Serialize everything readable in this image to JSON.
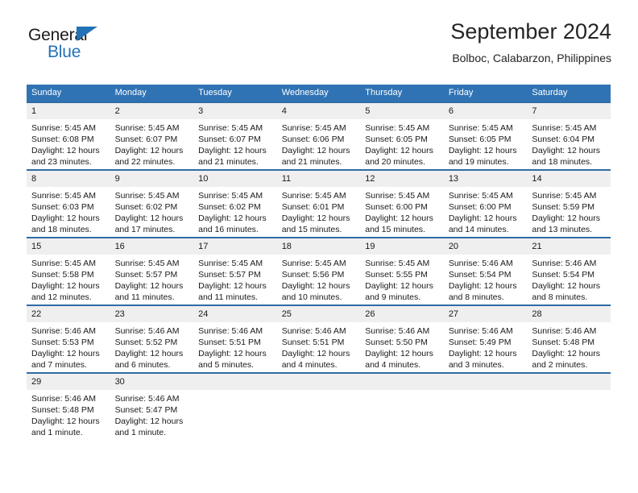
{
  "brand": {
    "name_top": "General",
    "name_bottom": "Blue",
    "accent_color": "#2272b8"
  },
  "header": {
    "title": "September 2024",
    "subtitle": "Bolboc, Calabarzon, Philippines"
  },
  "theme": {
    "header_blue": "#3073b4",
    "row_divider_blue": "#2e6da4",
    "daynum_gray": "#efefef"
  },
  "weekdays": [
    "Sunday",
    "Monday",
    "Tuesday",
    "Wednesday",
    "Thursday",
    "Friday",
    "Saturday"
  ],
  "weeks": [
    [
      {
        "day": "1",
        "sunrise": "Sunrise: 5:45 AM",
        "sunset": "Sunset: 6:08 PM",
        "daylight1": "Daylight: 12 hours",
        "daylight2": "and 23 minutes."
      },
      {
        "day": "2",
        "sunrise": "Sunrise: 5:45 AM",
        "sunset": "Sunset: 6:07 PM",
        "daylight1": "Daylight: 12 hours",
        "daylight2": "and 22 minutes."
      },
      {
        "day": "3",
        "sunrise": "Sunrise: 5:45 AM",
        "sunset": "Sunset: 6:07 PM",
        "daylight1": "Daylight: 12 hours",
        "daylight2": "and 21 minutes."
      },
      {
        "day": "4",
        "sunrise": "Sunrise: 5:45 AM",
        "sunset": "Sunset: 6:06 PM",
        "daylight1": "Daylight: 12 hours",
        "daylight2": "and 21 minutes."
      },
      {
        "day": "5",
        "sunrise": "Sunrise: 5:45 AM",
        "sunset": "Sunset: 6:05 PM",
        "daylight1": "Daylight: 12 hours",
        "daylight2": "and 20 minutes."
      },
      {
        "day": "6",
        "sunrise": "Sunrise: 5:45 AM",
        "sunset": "Sunset: 6:05 PM",
        "daylight1": "Daylight: 12 hours",
        "daylight2": "and 19 minutes."
      },
      {
        "day": "7",
        "sunrise": "Sunrise: 5:45 AM",
        "sunset": "Sunset: 6:04 PM",
        "daylight1": "Daylight: 12 hours",
        "daylight2": "and 18 minutes."
      }
    ],
    [
      {
        "day": "8",
        "sunrise": "Sunrise: 5:45 AM",
        "sunset": "Sunset: 6:03 PM",
        "daylight1": "Daylight: 12 hours",
        "daylight2": "and 18 minutes."
      },
      {
        "day": "9",
        "sunrise": "Sunrise: 5:45 AM",
        "sunset": "Sunset: 6:02 PM",
        "daylight1": "Daylight: 12 hours",
        "daylight2": "and 17 minutes."
      },
      {
        "day": "10",
        "sunrise": "Sunrise: 5:45 AM",
        "sunset": "Sunset: 6:02 PM",
        "daylight1": "Daylight: 12 hours",
        "daylight2": "and 16 minutes."
      },
      {
        "day": "11",
        "sunrise": "Sunrise: 5:45 AM",
        "sunset": "Sunset: 6:01 PM",
        "daylight1": "Daylight: 12 hours",
        "daylight2": "and 15 minutes."
      },
      {
        "day": "12",
        "sunrise": "Sunrise: 5:45 AM",
        "sunset": "Sunset: 6:00 PM",
        "daylight1": "Daylight: 12 hours",
        "daylight2": "and 15 minutes."
      },
      {
        "day": "13",
        "sunrise": "Sunrise: 5:45 AM",
        "sunset": "Sunset: 6:00 PM",
        "daylight1": "Daylight: 12 hours",
        "daylight2": "and 14 minutes."
      },
      {
        "day": "14",
        "sunrise": "Sunrise: 5:45 AM",
        "sunset": "Sunset: 5:59 PM",
        "daylight1": "Daylight: 12 hours",
        "daylight2": "and 13 minutes."
      }
    ],
    [
      {
        "day": "15",
        "sunrise": "Sunrise: 5:45 AM",
        "sunset": "Sunset: 5:58 PM",
        "daylight1": "Daylight: 12 hours",
        "daylight2": "and 12 minutes."
      },
      {
        "day": "16",
        "sunrise": "Sunrise: 5:45 AM",
        "sunset": "Sunset: 5:57 PM",
        "daylight1": "Daylight: 12 hours",
        "daylight2": "and 11 minutes."
      },
      {
        "day": "17",
        "sunrise": "Sunrise: 5:45 AM",
        "sunset": "Sunset: 5:57 PM",
        "daylight1": "Daylight: 12 hours",
        "daylight2": "and 11 minutes."
      },
      {
        "day": "18",
        "sunrise": "Sunrise: 5:45 AM",
        "sunset": "Sunset: 5:56 PM",
        "daylight1": "Daylight: 12 hours",
        "daylight2": "and 10 minutes."
      },
      {
        "day": "19",
        "sunrise": "Sunrise: 5:45 AM",
        "sunset": "Sunset: 5:55 PM",
        "daylight1": "Daylight: 12 hours",
        "daylight2": "and 9 minutes."
      },
      {
        "day": "20",
        "sunrise": "Sunrise: 5:46 AM",
        "sunset": "Sunset: 5:54 PM",
        "daylight1": "Daylight: 12 hours",
        "daylight2": "and 8 minutes."
      },
      {
        "day": "21",
        "sunrise": "Sunrise: 5:46 AM",
        "sunset": "Sunset: 5:54 PM",
        "daylight1": "Daylight: 12 hours",
        "daylight2": "and 8 minutes."
      }
    ],
    [
      {
        "day": "22",
        "sunrise": "Sunrise: 5:46 AM",
        "sunset": "Sunset: 5:53 PM",
        "daylight1": "Daylight: 12 hours",
        "daylight2": "and 7 minutes."
      },
      {
        "day": "23",
        "sunrise": "Sunrise: 5:46 AM",
        "sunset": "Sunset: 5:52 PM",
        "daylight1": "Daylight: 12 hours",
        "daylight2": "and 6 minutes."
      },
      {
        "day": "24",
        "sunrise": "Sunrise: 5:46 AM",
        "sunset": "Sunset: 5:51 PM",
        "daylight1": "Daylight: 12 hours",
        "daylight2": "and 5 minutes."
      },
      {
        "day": "25",
        "sunrise": "Sunrise: 5:46 AM",
        "sunset": "Sunset: 5:51 PM",
        "daylight1": "Daylight: 12 hours",
        "daylight2": "and 4 minutes."
      },
      {
        "day": "26",
        "sunrise": "Sunrise: 5:46 AM",
        "sunset": "Sunset: 5:50 PM",
        "daylight1": "Daylight: 12 hours",
        "daylight2": "and 4 minutes."
      },
      {
        "day": "27",
        "sunrise": "Sunrise: 5:46 AM",
        "sunset": "Sunset: 5:49 PM",
        "daylight1": "Daylight: 12 hours",
        "daylight2": "and 3 minutes."
      },
      {
        "day": "28",
        "sunrise": "Sunrise: 5:46 AM",
        "sunset": "Sunset: 5:48 PM",
        "daylight1": "Daylight: 12 hours",
        "daylight2": "and 2 minutes."
      }
    ],
    [
      {
        "day": "29",
        "sunrise": "Sunrise: 5:46 AM",
        "sunset": "Sunset: 5:48 PM",
        "daylight1": "Daylight: 12 hours",
        "daylight2": "and 1 minute."
      },
      {
        "day": "30",
        "sunrise": "Sunrise: 5:46 AM",
        "sunset": "Sunset: 5:47 PM",
        "daylight1": "Daylight: 12 hours",
        "daylight2": "and 1 minute."
      },
      {
        "day": "",
        "sunrise": "",
        "sunset": "",
        "daylight1": "",
        "daylight2": ""
      },
      {
        "day": "",
        "sunrise": "",
        "sunset": "",
        "daylight1": "",
        "daylight2": ""
      },
      {
        "day": "",
        "sunrise": "",
        "sunset": "",
        "daylight1": "",
        "daylight2": ""
      },
      {
        "day": "",
        "sunrise": "",
        "sunset": "",
        "daylight1": "",
        "daylight2": ""
      },
      {
        "day": "",
        "sunrise": "",
        "sunset": "",
        "daylight1": "",
        "daylight2": ""
      }
    ]
  ]
}
